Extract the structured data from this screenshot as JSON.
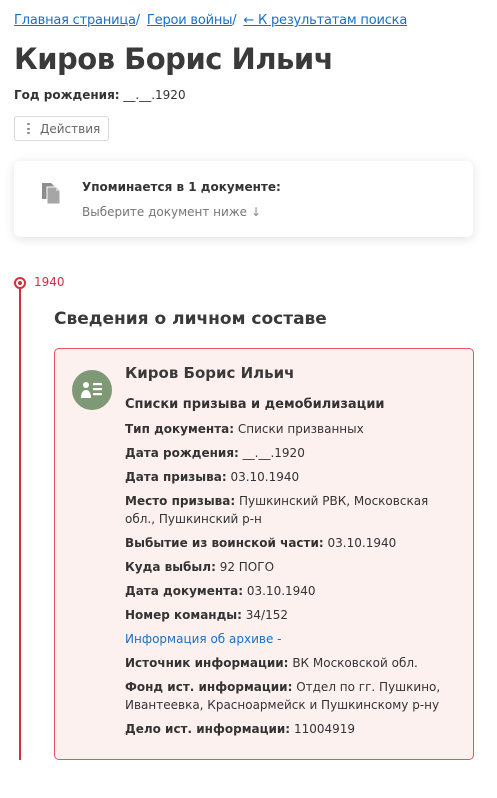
{
  "breadcrumb": {
    "items": [
      "Главная страница",
      "Герои войны",
      "← К результатам поиска"
    ],
    "separator": "/"
  },
  "person": {
    "name": "Киров Борис Ильич",
    "birth_label": "Год рождения:",
    "birth_value": "__.__.1920"
  },
  "actions_label": "Действия",
  "mention": {
    "title": "Упоминается в 1 документе:",
    "hint": "Выберите документ ниже",
    "hint_arrow": "↓"
  },
  "timeline": {
    "year": "1940",
    "section_title": "Сведения о личном составе"
  },
  "card": {
    "name": "Киров Борис Ильич",
    "doc_type_title": "Списки призыва и демобилизации",
    "fields": [
      {
        "label": "Тип документа:",
        "value": "Списки призванных"
      },
      {
        "label": "Дата рождения:",
        "value": "__.__.1920"
      },
      {
        "label": "Дата призыва:",
        "value": "03.10.1940"
      },
      {
        "label": "Место призыва:",
        "value": "Пушкинский РВК, Московская обл., Пушкинский р-н"
      },
      {
        "label": "Выбытие из воинской части:",
        "value": "03.10.1940"
      },
      {
        "label": "Куда выбыл:",
        "value": "92 ПОГО"
      },
      {
        "label": "Дата документа:",
        "value": "03.10.1940"
      },
      {
        "label": "Номер команды:",
        "value": "34/152"
      }
    ],
    "archive_link": "Информация об архиве -",
    "source_fields": [
      {
        "label": "Источник информации:",
        "value": "ВК Московской обл."
      },
      {
        "label": "Фонд ист. информации:",
        "value": "Отдел по гг. Пушкино, Ивантеевка, Красноармейск и Пушкинскому р-ну"
      },
      {
        "label": "Дело ист. информации:",
        "value": "11004919"
      }
    ]
  },
  "colors": {
    "link": "#1a6fc4",
    "accent_red": "#d32f3c",
    "card_bg": "#fdf1f0",
    "avatar_bg": "#7f9875"
  },
  "icons": [
    "document-icon",
    "arrow-down-icon",
    "more-vertical-icon",
    "person-list-icon",
    "timeline-dot-icon"
  ]
}
